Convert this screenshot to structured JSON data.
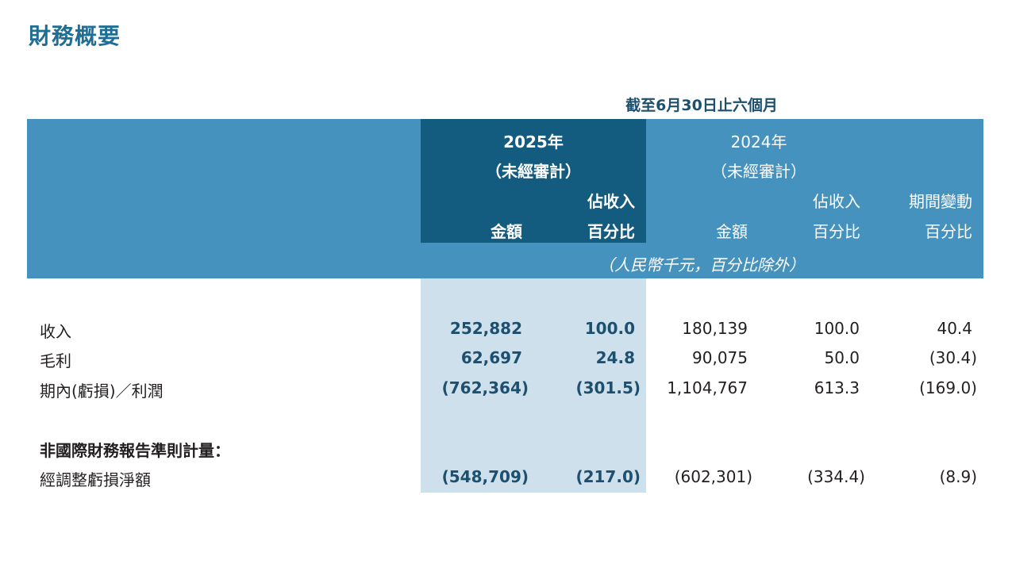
{
  "title": "財務概要",
  "period": "截至6月30日止六個月",
  "header": {
    "col2025_year": "2025年",
    "col2025_unaudited": "（未經審計）",
    "col2024_year": "2024年",
    "col2024_unaudited": "（未經審計）",
    "pct_of_revenue_top": "佔收入",
    "pct_of_revenue_bottom": "百分比",
    "amount": "金額",
    "change_top": "期間變動",
    "change_bottom": "百分比",
    "unit_note": "（人民幣千元，百分比除外）"
  },
  "rows": [
    {
      "label": "收入",
      "amount_2025": "252,882",
      "pct_2025": "100.0",
      "amount_2024": "180,139",
      "pct_2024": "100.0",
      "change": "40.4"
    },
    {
      "label": "毛利",
      "amount_2025": "62,697",
      "pct_2025": "24.8",
      "amount_2024": "90,075",
      "pct_2024": "50.0",
      "change": "(30.4)"
    },
    {
      "label": "期內(虧損)／利潤",
      "amount_2025": "(762,364)",
      "pct_2025": "(301.5)",
      "amount_2024": "1,104,767",
      "pct_2024": "613.3",
      "change": "(169.0)"
    }
  ],
  "non_ifrs_title": "非國際財務報告準則計量：",
  "non_ifrs_rows": [
    {
      "label": "經調整虧損淨額",
      "amount_2025": "(548,709)",
      "pct_2025": "(217.0)",
      "amount_2024": "(602,301)",
      "pct_2024": "(334.4)",
      "change": "(8.9)"
    }
  ]
}
